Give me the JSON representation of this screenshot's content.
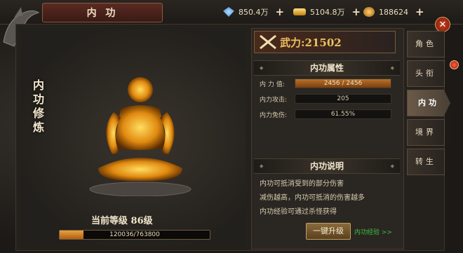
{
  "header": {
    "title": "内 功"
  },
  "resources": [
    {
      "icon": "diamond-icon",
      "value": "850.4万",
      "color": "#5ab0ff"
    },
    {
      "icon": "gold-ingot-icon",
      "value": "5104.8万",
      "color": "#f0c040"
    },
    {
      "icon": "coin-icon",
      "value": "188624",
      "color": "#e0a040"
    }
  ],
  "left": {
    "vertical_title": "内功修炼",
    "level_label": "当前等级 86级",
    "exp": {
      "text": "120036/763800",
      "current": 120036,
      "max": 763800
    }
  },
  "power": {
    "label": "武力:21502"
  },
  "attributes": {
    "title": "内功属性",
    "rows": [
      {
        "label": "内 力 值:",
        "value": "2456 / 2456",
        "fill": 1.0
      },
      {
        "label": "内力攻击:",
        "value": "205"
      },
      {
        "label": "内力免伤:",
        "value": "61.55%"
      }
    ]
  },
  "description": {
    "title": "内功说明",
    "lines": [
      "内功可抵消受到的部分伤害",
      "减伤越高，内功可抵消的伤害越多",
      "内功经验可通过杀怪获得"
    ]
  },
  "buttons": {
    "upgrade": "一键升级",
    "exp_link": "内功经验 >>"
  },
  "tabs": [
    {
      "label": "角色"
    },
    {
      "label": "头衔"
    },
    {
      "label": "内功"
    },
    {
      "label": "境界"
    },
    {
      "label": "转生"
    }
  ]
}
